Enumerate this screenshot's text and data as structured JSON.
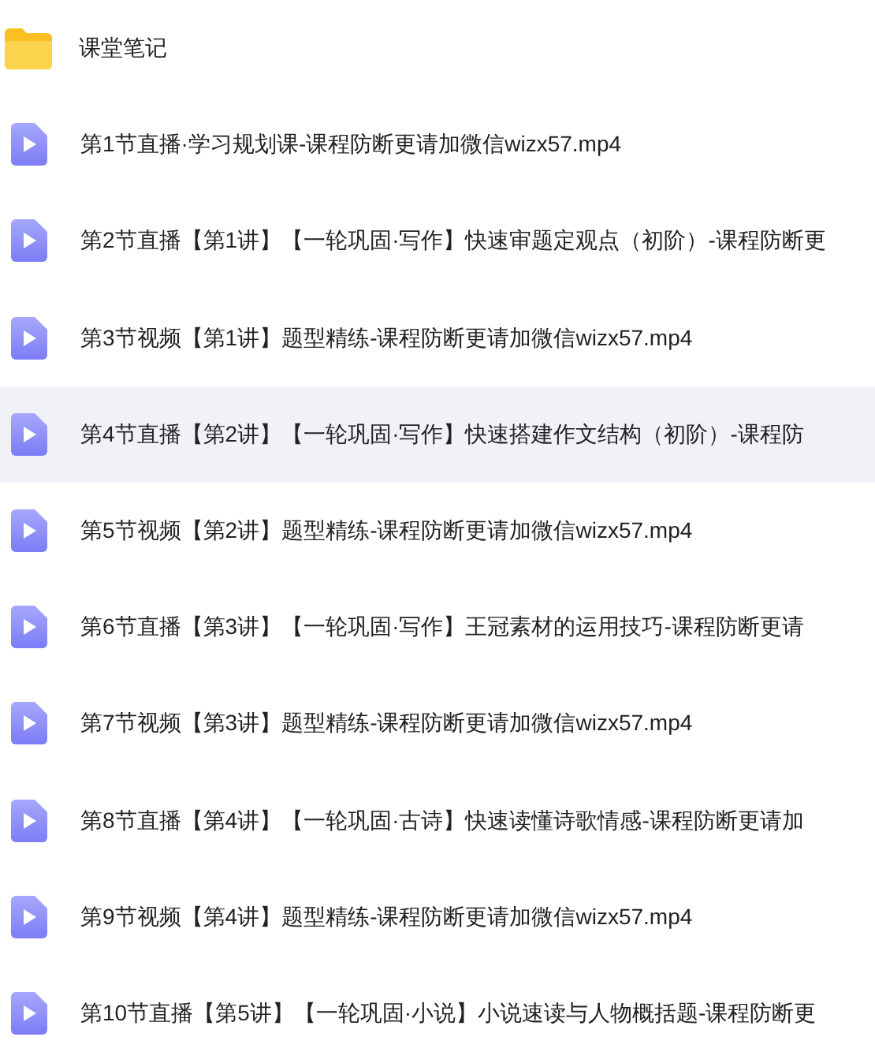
{
  "files": [
    {
      "kind": "folder",
      "name": "课堂笔记",
      "selected": false
    },
    {
      "kind": "video",
      "name": "第1节直播·学习规划课-课程防断更请加微信wizx57.mp4",
      "selected": false
    },
    {
      "kind": "video",
      "name": "第2节直播【第1讲】【一轮巩固·写作】快速审题定观点（初阶）-课程防断更",
      "selected": false
    },
    {
      "kind": "video",
      "name": "第3节视频【第1讲】题型精练-课程防断更请加微信wizx57.mp4",
      "selected": false
    },
    {
      "kind": "video",
      "name": "第4节直播【第2讲】【一轮巩固·写作】快速搭建作文结构（初阶）-课程防",
      "selected": true
    },
    {
      "kind": "video",
      "name": "第5节视频【第2讲】题型精练-课程防断更请加微信wizx57.mp4",
      "selected": false
    },
    {
      "kind": "video",
      "name": "第6节直播【第3讲】【一轮巩固·写作】王冠素材的运用技巧-课程防断更请",
      "selected": false
    },
    {
      "kind": "video",
      "name": "第7节视频【第3讲】题型精练-课程防断更请加微信wizx57.mp4",
      "selected": false
    },
    {
      "kind": "video",
      "name": "第8节直播【第4讲】【一轮巩固·古诗】快速读懂诗歌情感-课程防断更请加",
      "selected": false
    },
    {
      "kind": "video",
      "name": "第9节视频【第4讲】题型精练-课程防断更请加微信wizx57.mp4",
      "selected": false
    },
    {
      "kind": "video",
      "name": "第10节直播【第5讲】【一轮巩固·小说】小说速读与人物概括题-课程防断更",
      "selected": false
    }
  ]
}
